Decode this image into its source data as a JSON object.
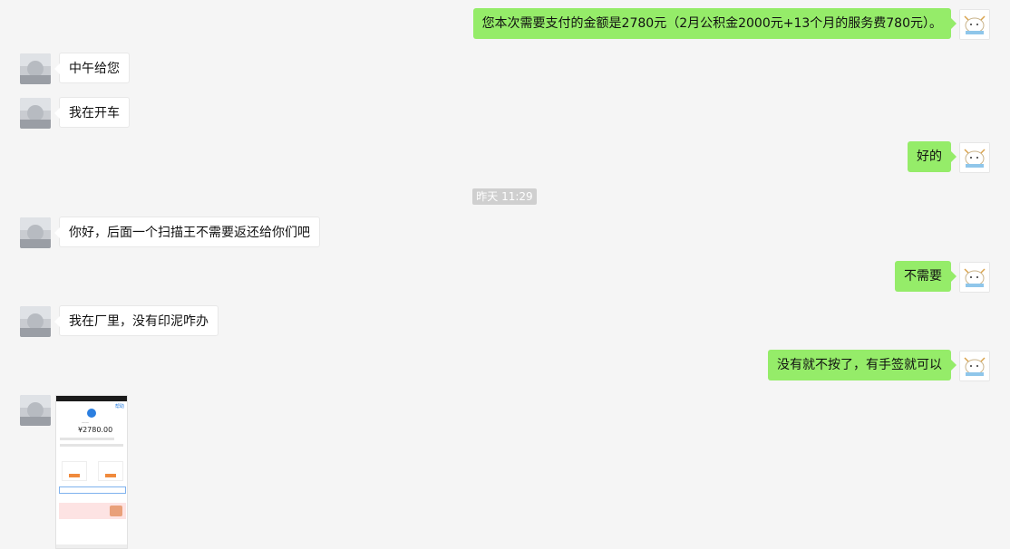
{
  "timestamp": "昨天 11:29",
  "messages": [
    {
      "side": "right",
      "text": "您本次需要支付的金额是2780元（2月公积金2000元+13个月的服务费780元）。"
    },
    {
      "side": "left",
      "text": "中午给您"
    },
    {
      "side": "left",
      "text": "我在开车"
    },
    {
      "side": "right",
      "text": "好的"
    },
    {
      "side": "left",
      "text": "你好，后面一个扫描王不需要返还给你们吧"
    },
    {
      "side": "right",
      "text": "不需要"
    },
    {
      "side": "left",
      "text": "我在厂里，没有印泥咋办"
    },
    {
      "side": "right",
      "text": "没有就不按了，有手签就可以"
    }
  ],
  "payment_screenshot": {
    "amount": "¥2780.00",
    "help": "帮助"
  },
  "colors": {
    "background": "#f5f5f5",
    "my_bubble": "#95ec69",
    "their_bubble": "#ffffff"
  }
}
